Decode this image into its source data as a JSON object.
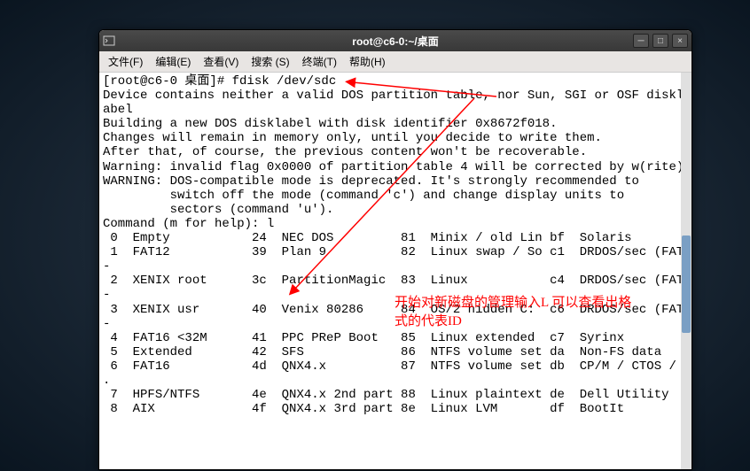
{
  "window": {
    "title": "root@c6-0:~/桌面"
  },
  "menu": {
    "file": "文件(F)",
    "edit": "编辑(E)",
    "view": "查看(V)",
    "search": "搜索 (S)",
    "terminal": "终端(T)",
    "help": "帮助(H)"
  },
  "terminal": {
    "prompt": "[root@c6-0 桌面]# fdisk /dev/sdc",
    "line1": "Device contains neither a valid DOS partition table, nor Sun, SGI or OSF disklabel",
    "line2": "Building a new DOS disklabel with disk identifier 0x8672f018.",
    "line3": "Changes will remain in memory only, until you decide to write them.",
    "line4": "After that, of course, the previous content won't be recoverable.",
    "blank1": "",
    "line5": "Warning: invalid flag 0x0000 of partition table 4 will be corrected by w(rite)",
    "blank2": "",
    "line6": "WARNING: DOS-compatible mode is deprecated. It's strongly recommended to",
    "line7": "         switch off the mode (command 'c') and change display units to",
    "line8": "         sectors (command 'u').",
    "blank3": "",
    "line9": "Command (m for help): l",
    "blank4": "",
    "row0": " 0  Empty           24  NEC DOS         81  Minix / old Lin bf  Solaris        ",
    "row1": " 1  FAT12           39  Plan 9          82  Linux swap / So c1  DRDOS/sec (FAT-",
    "row2": " 2  XENIX root      3c  PartitionMagic  83  Linux           c4  DRDOS/sec (FAT-",
    "row3": " 3  XENIX usr       40  Venix 80286     84  OS/2 hidden C:  c6  DRDOS/sec (FAT-",
    "row4": " 4  FAT16 <32M      41  PPC PReP Boot   85  Linux extended  c7  Syrinx         ",
    "row5": " 5  Extended        42  SFS             86  NTFS volume set da  Non-FS data    ",
    "row6": " 6  FAT16           4d  QNX4.x          87  NTFS volume set db  CP/M / CTOS / .",
    "row7": " 7  HPFS/NTFS       4e  QNX4.x 2nd part 88  Linux plaintext de  Dell Utility   ",
    "row8": " 8  AIX             4f  QNX4.x 3rd part 8e  Linux LVM       df  BootIt         "
  },
  "annotation": {
    "text1": "开始对新磁盘的管理输入L 可以查看出格",
    "text2": "式的代表ID"
  }
}
